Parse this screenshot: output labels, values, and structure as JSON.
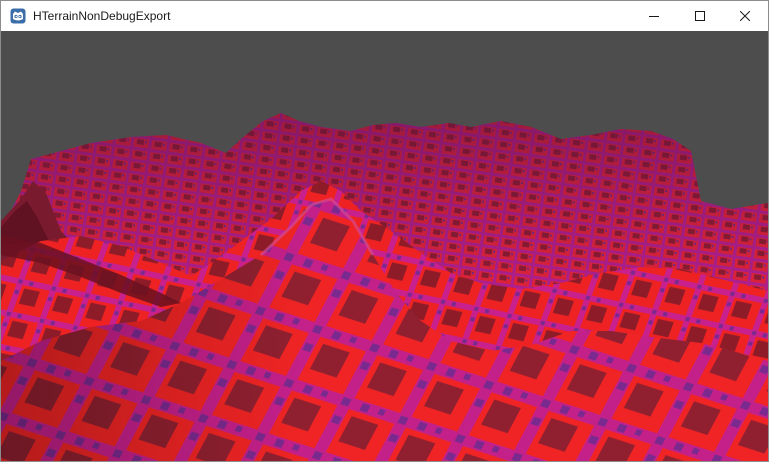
{
  "window": {
    "title": "HTerrainNonDebugExport",
    "app_icon": "godot-engine-icon",
    "controls": {
      "minimize_icon": "minimize-icon",
      "maximize_icon": "maximize-icon",
      "close_icon": "close-icon"
    }
  },
  "viewport": {
    "scene": "3d-terrain-render",
    "sky_color": "#4d4d4d",
    "terrain_colors": {
      "base_red": "#ee2222",
      "magenta": "#c8208c",
      "purple": "#7a2a8e",
      "dark_red": "#8e1c28",
      "shadow": "#5a1020"
    }
  }
}
